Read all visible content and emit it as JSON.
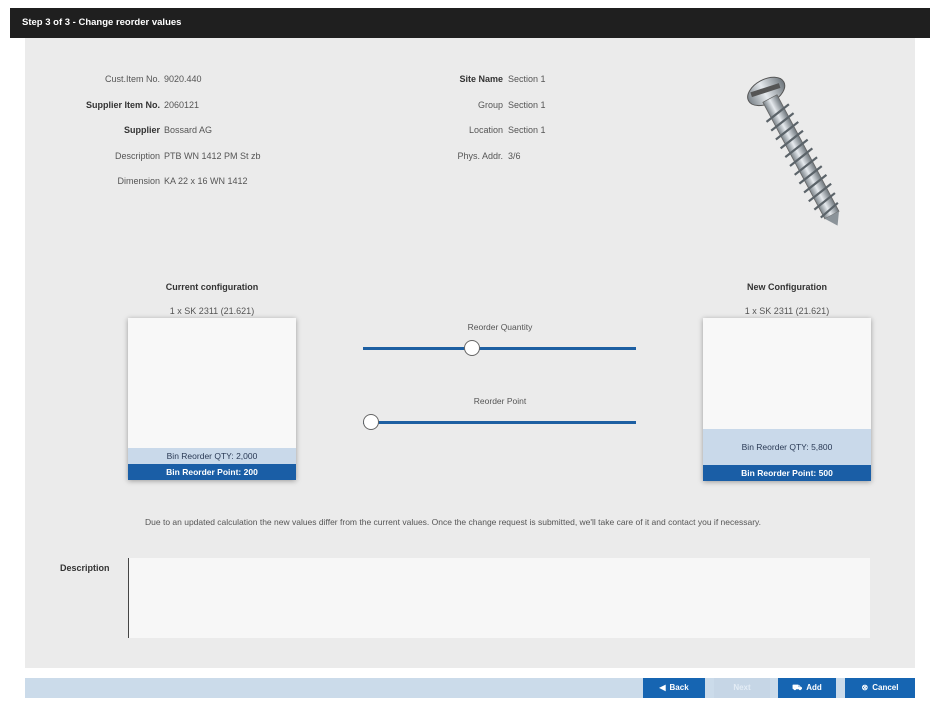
{
  "window": {
    "title": "Step 3 of 3 - Change reorder values"
  },
  "details_left": [
    {
      "label": "Cust.Item No.",
      "value": "9020.440",
      "bold": false
    },
    {
      "label": "Supplier Item No.",
      "value": "2060121",
      "bold": true
    },
    {
      "label": "Supplier",
      "value": "Bossard AG",
      "bold": true
    },
    {
      "label": "Description",
      "value": "PTB WN 1412 PM St zb",
      "bold": false
    },
    {
      "label": "Dimension",
      "value": "KA 22 x 16 WN 1412",
      "bold": false
    }
  ],
  "details_right": [
    {
      "label": "Site Name",
      "value": "Section 1",
      "bold": true
    },
    {
      "label": "Group",
      "value": "Section 1",
      "bold": false
    },
    {
      "label": "Location",
      "value": "Section 1",
      "bold": false
    },
    {
      "label": "Phys. Addr.",
      "value": "3/6",
      "bold": false
    }
  ],
  "current": {
    "title": "Current configuration",
    "bin": "1 x SK 2311 (21.621)",
    "reorder_qty": "Bin Reorder QTY: 2,000",
    "reorder_point": "Bin Reorder Point: 200"
  },
  "new": {
    "title": "New Configuration",
    "bin": "1 x SK 2311 (21.621)",
    "reorder_qty": "Bin Reorder QTY: 5,800",
    "reorder_point": "Bin Reorder Point: 500"
  },
  "sliders": {
    "quantity_label": "Reorder Quantity",
    "quantity_value": 0.4,
    "point_label": "Reorder Point",
    "point_value": 0.0
  },
  "note": "Due to an updated calculation the new values differ from the current values. Once the change request is submitted, we'll take care of it and contact you if necessary.",
  "description": {
    "label": "Description",
    "value": ""
  },
  "buttons": {
    "back": "Back",
    "next": "Next",
    "add": "Add",
    "cancel": "Cancel"
  },
  "colors": {
    "accent": "#1665b2",
    "titlebar": "#1f1f1f",
    "panel": "#ebebeb"
  },
  "icons": {
    "back": "arrow-left-icon",
    "add": "cart-icon",
    "cancel": "close-circle-icon",
    "product": "screw-image"
  }
}
